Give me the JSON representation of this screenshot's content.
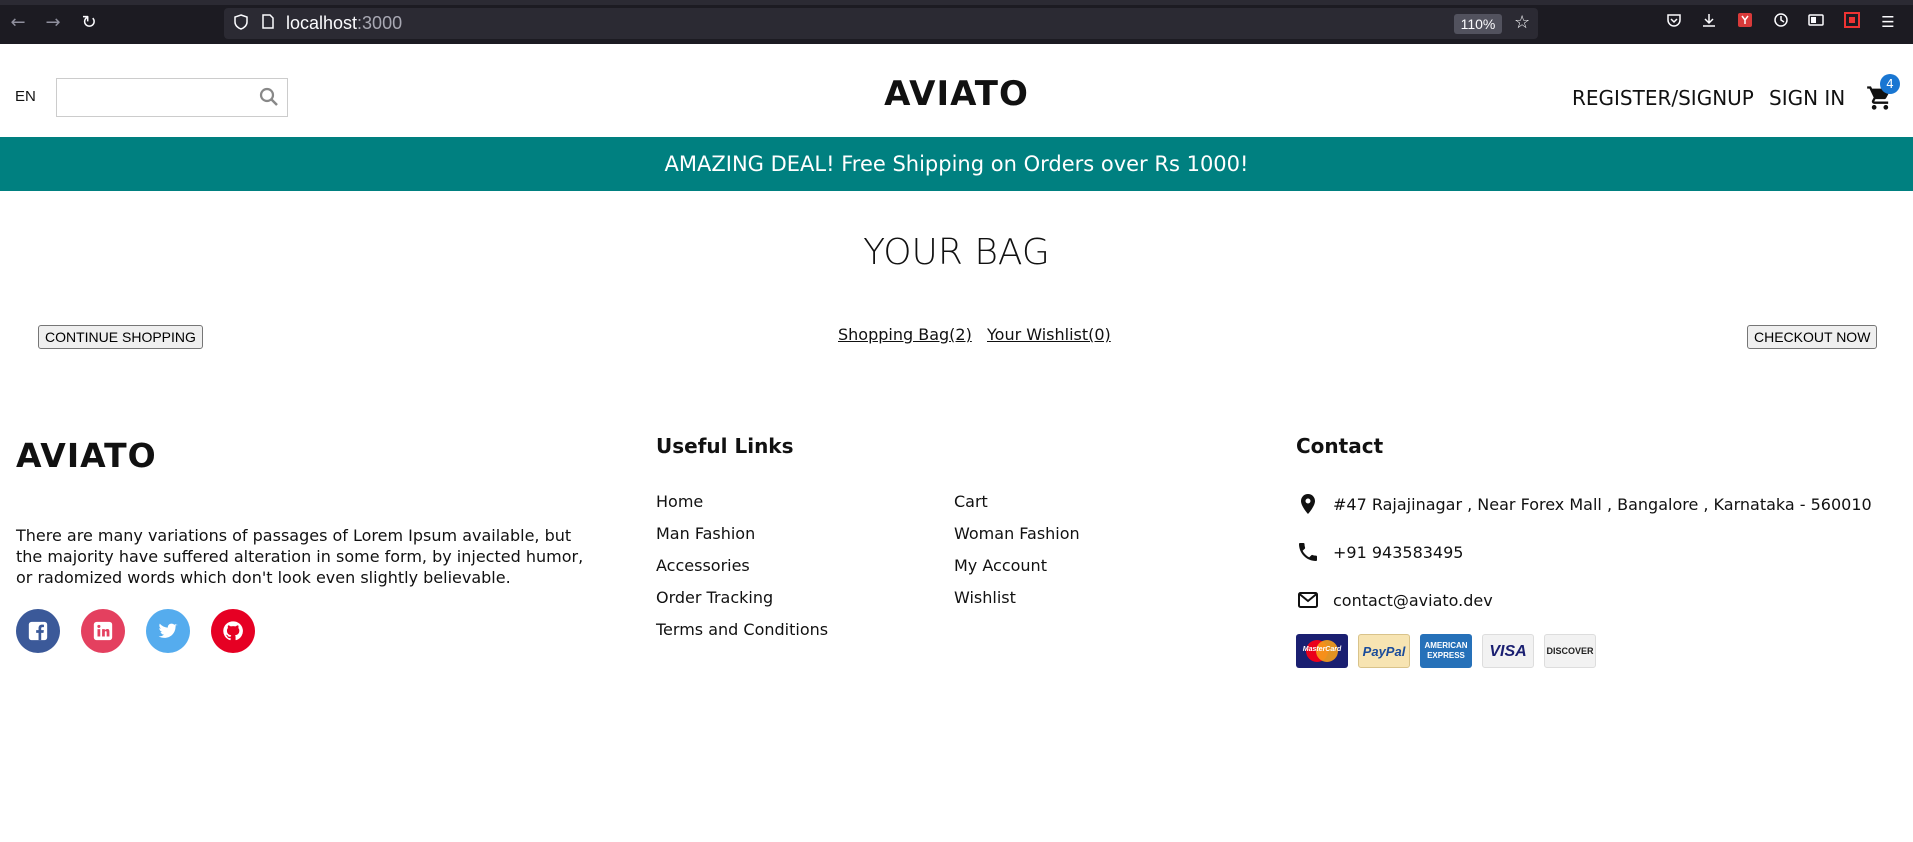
{
  "browser": {
    "url_host": "localhost",
    "url_port": ":3000",
    "zoom": "110%",
    "icons": [
      "back-icon",
      "forward-icon",
      "reload-icon",
      "shield-icon",
      "page-icon",
      "star-icon",
      "pocket-icon",
      "download-icon",
      "extension-icon",
      "history-icon",
      "reader-icon",
      "screenshot-icon",
      "menu-icon"
    ]
  },
  "header": {
    "lang": "EN",
    "logo": "AVIATO",
    "register_label": "REGISTER/SIGNUP",
    "signin_label": "SIGN IN",
    "cart_count": "4"
  },
  "announcement": {
    "text": "AMAZING DEAL! Free Shipping on Orders over Rs 1000!",
    "bg_color": "#008080"
  },
  "bag": {
    "title": "YOUR BAG",
    "continue_label": "CONTINUE SHOPPING",
    "shopping_bag_link": "Shopping Bag(2)",
    "wishlist_link": "Your Wishlist(0)",
    "checkout_label": "CHECKOUT NOW"
  },
  "footer": {
    "logo": "AVIATO",
    "description": "There are many variations of passages of Lorem Ipsum available, but the majority have suffered alteration in some form, by injected humor, or radomized words which don't look even slightly believable.",
    "social": [
      {
        "name": "facebook-icon",
        "color": "#3b5999"
      },
      {
        "name": "linkedin-icon",
        "color": "#e4405f"
      },
      {
        "name": "twitter-icon",
        "color": "#55acee"
      },
      {
        "name": "github-icon",
        "color": "#e60023"
      }
    ],
    "links_heading": "Useful Links",
    "links": [
      "Home",
      "Cart",
      "Man Fashion",
      "Woman Fashion",
      "Accessories",
      "My Account",
      "Order Tracking",
      "Wishlist",
      "Terms and Conditions"
    ],
    "contact_heading": "Contact",
    "address": "#47 Rajajinagar , Near Forex Mall , Bangalore , Karnataka - 560010",
    "phone": "+91 943583495",
    "email": "contact@aviato.dev",
    "payment_methods": [
      "MasterCard",
      "PayPal",
      "AMERICAN EXPRESS",
      "VISA",
      "DISCOVER"
    ]
  }
}
